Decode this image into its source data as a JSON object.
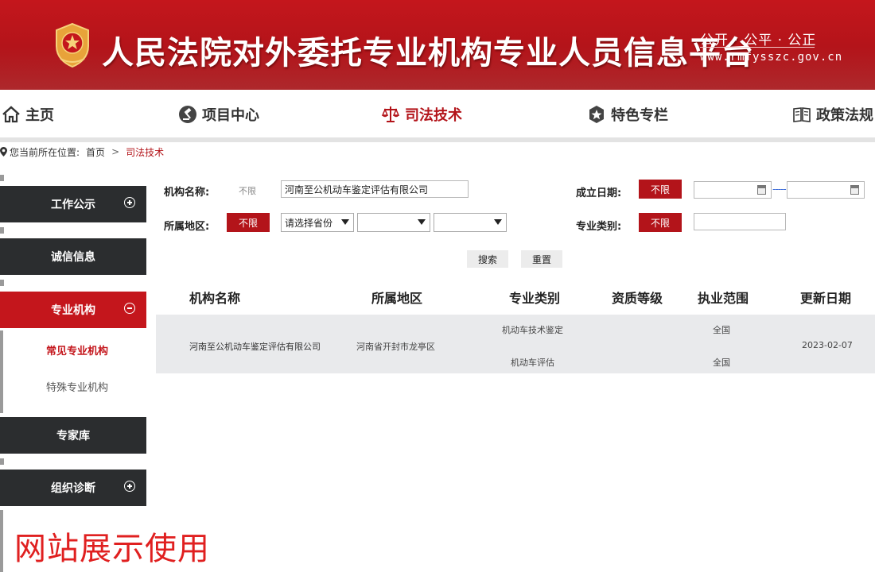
{
  "header": {
    "title": "人民法院对外委托专业机构专业人员信息平台",
    "slogan": "公开 · 公平 · 公正",
    "domain": "www.rmfysszc.gov.cn"
  },
  "nav": [
    {
      "label": "主页",
      "icon": "home-icon"
    },
    {
      "label": "项目中心",
      "icon": "gavel-icon"
    },
    {
      "label": "司法技术",
      "icon": "scales-icon",
      "active": true
    },
    {
      "label": "特色专栏",
      "icon": "star-badge-icon"
    },
    {
      "label": "政策法规",
      "icon": "book-icon"
    }
  ],
  "breadcrumb": {
    "prefix": "您当前所在位置:",
    "home": "首页",
    "separator": ">",
    "current": "司法技术"
  },
  "sidebar": {
    "work_notice": "工作公示",
    "credit_info": "诚信信息",
    "professional_org": "专业机构",
    "sub_common": "常见专业机构",
    "sub_special": "特殊专业机构",
    "expert_db": "专家库",
    "org_diagnosis": "组织诊断"
  },
  "form": {
    "org_name_label": "机构名称:",
    "org_name_tag": "不限",
    "org_name_value": "河南至公机动车鉴定评估有限公司",
    "founded_label": "成立日期:",
    "founded_tag": "不限",
    "founded_from": "",
    "founded_to": "",
    "date_dash": "-----",
    "region_label": "所属地区:",
    "region_tag": "不限",
    "province_select": "请选择省份",
    "city_select": "",
    "district_select": "",
    "category_label": "专业类别:",
    "category_tag": "不限",
    "category_value": "",
    "search_button": "搜索",
    "reset_button": "重置"
  },
  "table": {
    "headers": [
      "机构名称",
      "所属地区",
      "专业类别",
      "资质等级",
      "执业范围",
      "更新日期"
    ],
    "rows": [
      {
        "name": "河南至公机动车鉴定评估有限公司",
        "region": "河南省开封市龙亭区",
        "categories": [
          "机动车技术鉴定",
          "机动车评估"
        ],
        "level": "",
        "scopes": [
          "全国",
          "全国"
        ],
        "updated": "2023-02-07"
      }
    ]
  },
  "watermark": "网站展示使用",
  "colors": {
    "brand_red": "#c4161c",
    "sidebar_dark": "#2b2d2f"
  }
}
